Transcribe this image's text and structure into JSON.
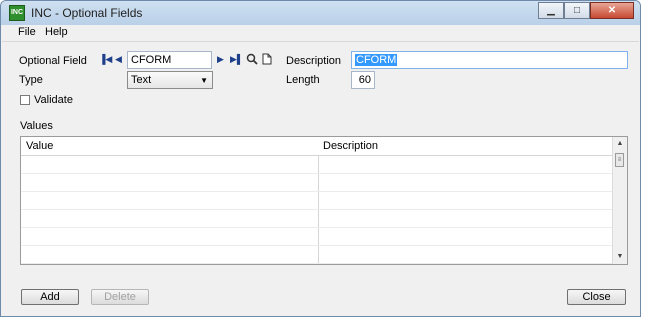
{
  "window": {
    "title": "INC - Optional Fields",
    "icon": "app-icon"
  },
  "menu": [
    "File",
    "Help"
  ],
  "form": {
    "optional_field_label": "Optional Field",
    "optional_field_value": "CFORM",
    "description_label": "Description",
    "description_value": "CFORM",
    "type_label": "Type",
    "type_value": "Text",
    "length_label": "Length",
    "length_value": "60",
    "validate_label": "Validate",
    "validate_checked": false
  },
  "values": {
    "section_label": "Values",
    "columns": [
      "Value",
      "Description"
    ],
    "rows": [
      [
        "",
        ""
      ],
      [
        "",
        ""
      ],
      [
        "",
        ""
      ],
      [
        "",
        ""
      ],
      [
        "",
        ""
      ],
      [
        "",
        ""
      ]
    ]
  },
  "buttons": {
    "add": "Add",
    "delete": "Delete",
    "close": "Close"
  },
  "icons": {
    "first": "first-record-icon",
    "prev": "previous-record-icon",
    "next": "next-record-icon",
    "last": "last-record-icon",
    "finder": "search-icon",
    "new": "new-document-icon"
  },
  "colors": {
    "selection": "#3399ff"
  }
}
